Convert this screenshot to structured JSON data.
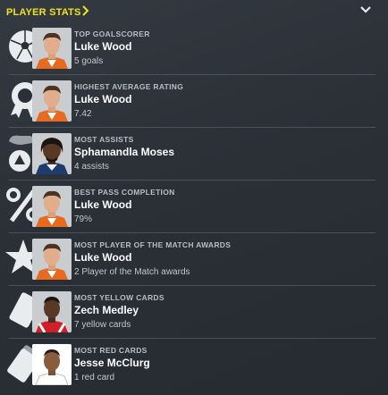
{
  "header": {
    "title": "PLAYER STATS",
    "chevron_icon": "chevron-right-icon",
    "collapse_icon": "chevron-down-icon"
  },
  "colors": {
    "accent": "#f2e21a",
    "background": "#2b3037"
  },
  "stats": [
    {
      "category": "TOP GOALSCORER",
      "player": "Luke Wood",
      "value": "5 goals",
      "icon": "football-icon"
    },
    {
      "category": "HIGHEST AVERAGE RATING",
      "player": "Luke Wood",
      "value": "7.42",
      "icon": "rating-badge-icon"
    },
    {
      "category": "MOST ASSISTS",
      "player": "Sphamandla Moses",
      "value": "4 assists",
      "icon": "assist-icon"
    },
    {
      "category": "BEST PASS COMPLETION",
      "player": "Luke Wood",
      "value": "79%",
      "icon": "percent-icon"
    },
    {
      "category": "MOST PLAYER OF THE MATCH AWARDS",
      "player": "Luke Wood",
      "value": "2 Player of the Match awards",
      "icon": "star-icon"
    },
    {
      "category": "MOST YELLOW CARDS",
      "player": "Zech Medley",
      "value": "7 yellow cards",
      "icon": "yellow-card-icon"
    },
    {
      "category": "MOST RED CARDS",
      "player": "Jesse McClurg",
      "value": "1 red card",
      "icon": "red-card-icon"
    }
  ]
}
